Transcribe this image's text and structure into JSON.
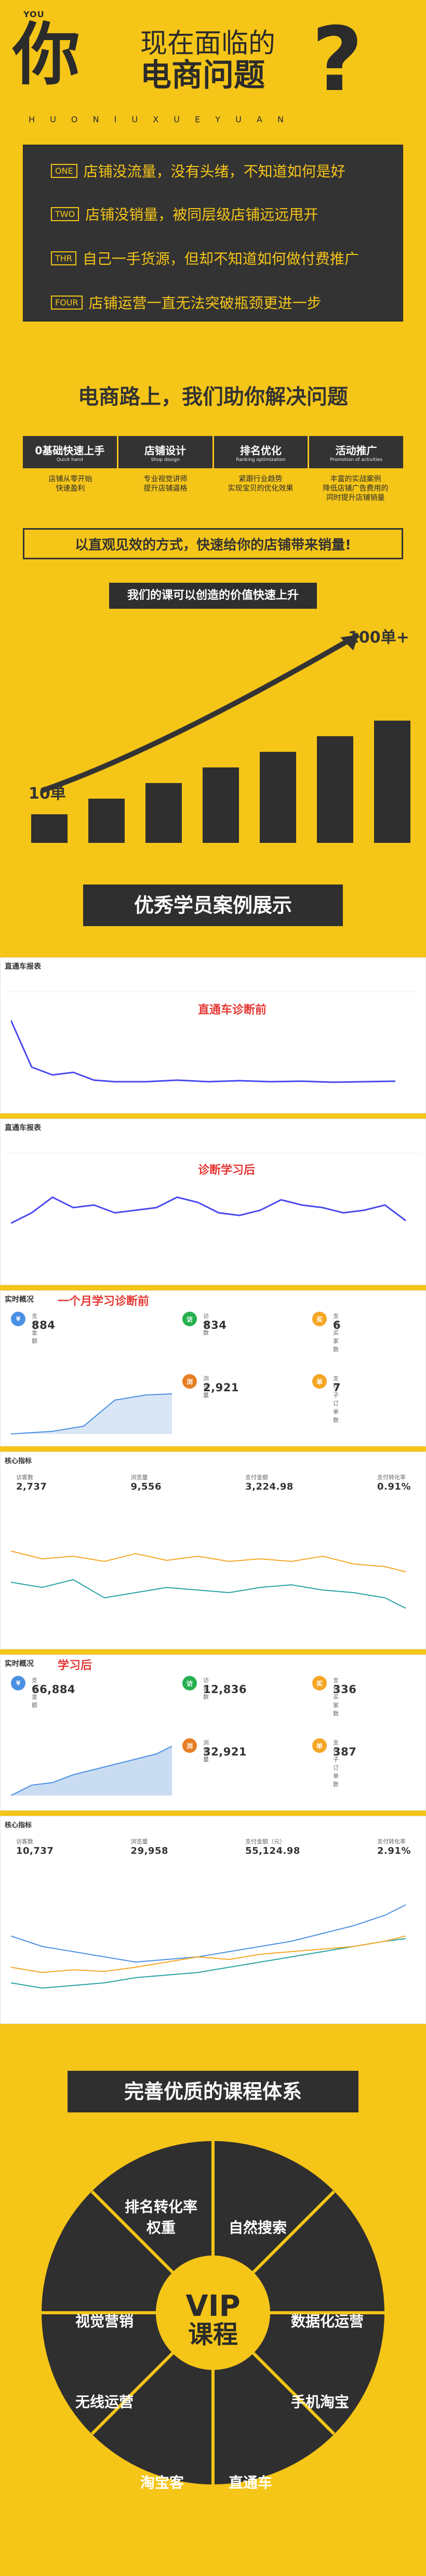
{
  "hero": {
    "you": "YOU",
    "ni": "你",
    "line1": "现在面临的",
    "line2": "电商问题",
    "question": "?",
    "pinyin": "H U O N I U X U E Y U A N",
    "items": [
      {
        "tag": "ONE",
        "text": "店铺没流量，没有头绪，不知道如何是好"
      },
      {
        "tag": "TWO",
        "text": "店铺没销量，被同层级店铺远远甩开"
      },
      {
        "tag": "THR",
        "text": "自己一手货源，但却不知道如何做付费推广"
      },
      {
        "tag": "FOUR",
        "text": "店铺运营一直无法突破瓶颈更进一步"
      }
    ]
  },
  "help": {
    "title": "电商路上，我们助你解决问题",
    "tabs": [
      {
        "title": "0基础快速上手",
        "sub": "Quick hand",
        "desc1": "店铺从零开始",
        "desc2": "快速盈利"
      },
      {
        "title": "店铺设计",
        "sub": "Shop design",
        "desc1": "专业视觉讲师",
        "desc2": "提升店铺逼格"
      },
      {
        "title": "排名优化",
        "sub": "Ranking optimization",
        "desc1": "紧跟行业趋势",
        "desc2": "实现宝贝的优化效果"
      },
      {
        "title": "活动推广",
        "sub": "Promotion of activities",
        "desc1": "丰富的实战案例",
        "desc2": "降低店铺广告费用的",
        "desc3": "同时提升店铺销量"
      }
    ],
    "slogan": "以直观见效的方式，快速给你的店铺带来销量!"
  },
  "growth": {
    "banner": "我们的课可以创造的价值快速上升",
    "start": "10单",
    "end": "100单+",
    "bars": [
      1,
      2,
      3,
      4,
      5,
      6,
      7
    ]
  },
  "cases": {
    "title": "优秀学员案例展示",
    "panel1_title": "直通车报表",
    "panel1_label": "直通车诊断前",
    "panel2_title": "直通车报表",
    "panel2_label": "诊断学习后",
    "panel3_title": "实时概况",
    "panel3_label": "一个月学习诊断前",
    "panel4_title": "核心指标",
    "panel5_title": "实时概况",
    "panel5_label": "学习后",
    "panel6_title": "核心指标",
    "kpis_before": [
      {
        "label": "支付金额",
        "value": "884"
      },
      {
        "label": "访客数",
        "value": "834"
      },
      {
        "label": "支付买家数",
        "value": "6"
      },
      {
        "label": "浏览量",
        "value": "2,921"
      },
      {
        "label": "支付子订单数",
        "value": "7"
      }
    ],
    "kpis_after": [
      {
        "label": "支付金额",
        "value": "66,884"
      },
      {
        "label": "访客数",
        "value": "12,836"
      },
      {
        "label": "支付买家数",
        "value": "336"
      },
      {
        "label": "浏览量",
        "value": "32,921"
      },
      {
        "label": "支付子订单数",
        "value": "387"
      }
    ],
    "core_before": [
      {
        "label": "访客数",
        "value": "2,737"
      },
      {
        "label": "浏览量",
        "value": "9,556"
      },
      {
        "label": "支付金额",
        "value": "3,224.98"
      },
      {
        "label": "支付转化率",
        "value": "0.91%"
      }
    ],
    "core_after": [
      {
        "label": "访客数",
        "value": "10,737"
      },
      {
        "label": "浏览量",
        "value": "29,958"
      },
      {
        "label": "支付金额（元）",
        "value": "55,124.98"
      },
      {
        "label": "支付转化率",
        "value": "2.91%"
      }
    ]
  },
  "system": {
    "title": "完善优质的课程体系",
    "center1": "VIP",
    "center2": "课程",
    "segments": [
      "排名转化率\n权重",
      "自然搜索",
      "数据化运营",
      "手机淘宝",
      "直通车",
      "淘宝客",
      "无线运营",
      "视觉营销"
    ]
  }
}
